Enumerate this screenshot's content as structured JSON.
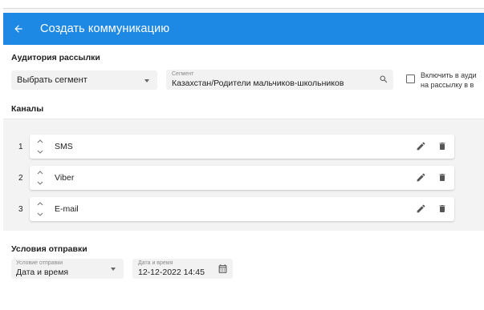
{
  "header": {
    "title": "Создать коммуникацию",
    "back_icon": "arrow-back-icon",
    "color": "#1e88e5"
  },
  "audience": {
    "title": "Аудитория рассылки",
    "segment_select": {
      "value": "Выбрать сегмент"
    },
    "segment_field": {
      "label": "Сегмент",
      "value": "Казахстан/Родители мальчиков-школьников",
      "icon": "search-icon"
    },
    "checkbox": {
      "checked": false,
      "label_line1": "Включить в ауди",
      "label_line2": "на рассылку в в"
    }
  },
  "channels": {
    "title": "Каналы",
    "items": [
      {
        "number": "1",
        "label": "SMS"
      },
      {
        "number": "2",
        "label": "Viber"
      },
      {
        "number": "3",
        "label": "E-mail"
      }
    ]
  },
  "conditions": {
    "title": "Условия отправки",
    "condition_select": {
      "label": "Условие отправки",
      "value": "Дата и время"
    },
    "datetime_field": {
      "label": "Дата и время",
      "value": "12-12-2022 14:45",
      "icon": "calendar-icon"
    }
  }
}
